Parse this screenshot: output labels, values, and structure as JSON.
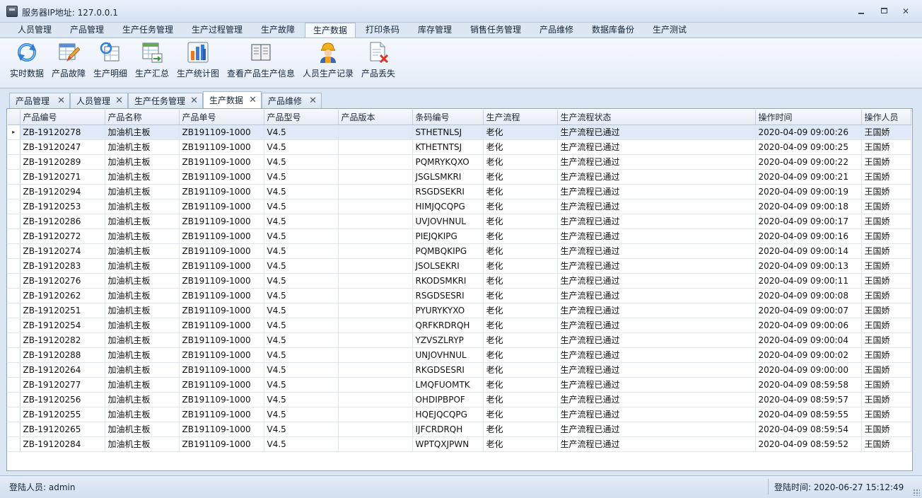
{
  "window": {
    "title": "服务器IP地址: 127.0.0.1",
    "app_icon": "server-icon"
  },
  "ribbon": {
    "tabs": [
      {
        "label": "人员管理"
      },
      {
        "label": "产品管理"
      },
      {
        "label": "生产任务管理"
      },
      {
        "label": "生产过程管理"
      },
      {
        "label": "生产故障"
      },
      {
        "label": "生产数据",
        "active": true
      },
      {
        "label": "打印条码"
      },
      {
        "label": "库存管理"
      },
      {
        "label": "销售任务管理"
      },
      {
        "label": "产品维修"
      },
      {
        "label": "数据库备份"
      },
      {
        "label": "生产测试"
      }
    ],
    "buttons": [
      {
        "label": "实时数据",
        "icon": "refresh-icon"
      },
      {
        "label": "产品故障",
        "icon": "edit-table-icon"
      },
      {
        "label": "生产明细",
        "icon": "detail-sync-icon"
      },
      {
        "label": "生产汇总",
        "icon": "summary-table-icon"
      },
      {
        "label": "生产统计图",
        "icon": "bar-chart-icon"
      },
      {
        "label": "查看产品生产信息",
        "icon": "book-icon"
      },
      {
        "label": "人员生产记录",
        "icon": "worker-icon"
      },
      {
        "label": "产品丢失",
        "icon": "delete-document-icon"
      }
    ]
  },
  "doc_tabs": [
    {
      "label": "产品管理"
    },
    {
      "label": "人员管理"
    },
    {
      "label": "生产任务管理"
    },
    {
      "label": "生产数据",
      "active": true
    },
    {
      "label": "产品维修"
    }
  ],
  "grid": {
    "columns": [
      "产品编号",
      "产品名称",
      "产品单号",
      "产品型号",
      "产品版本",
      "条码编号",
      "生产流程",
      "生产流程状态",
      "操作时间",
      "操作人员"
    ],
    "rows": [
      [
        "ZB-19120278",
        "加油机主板",
        "ZB191109-1000",
        "V4.5",
        "",
        "STHETNLSJ",
        "老化",
        "生产流程已通过",
        "2020-04-09 09:00:26",
        "王国娇"
      ],
      [
        "ZB-19120247",
        "加油机主板",
        "ZB191109-1000",
        "V4.5",
        "",
        "KTHETNTSJ",
        "老化",
        "生产流程已通过",
        "2020-04-09 09:00:25",
        "王国娇"
      ],
      [
        "ZB-19120289",
        "加油机主板",
        "ZB191109-1000",
        "V4.5",
        "",
        "PQMRYKQXO",
        "老化",
        "生产流程已通过",
        "2020-04-09 09:00:22",
        "王国娇"
      ],
      [
        "ZB-19120271",
        "加油机主板",
        "ZB191109-1000",
        "V4.5",
        "",
        "JSGLSMKRI",
        "老化",
        "生产流程已通过",
        "2020-04-09 09:00:21",
        "王国娇"
      ],
      [
        "ZB-19120294",
        "加油机主板",
        "ZB191109-1000",
        "V4.5",
        "",
        "RSGDSEKRI",
        "老化",
        "生产流程已通过",
        "2020-04-09 09:00:19",
        "王国娇"
      ],
      [
        "ZB-19120253",
        "加油机主板",
        "ZB191109-1000",
        "V4.5",
        "",
        "HIMJQCQPG",
        "老化",
        "生产流程已通过",
        "2020-04-09 09:00:18",
        "王国娇"
      ],
      [
        "ZB-19120286",
        "加油机主板",
        "ZB191109-1000",
        "V4.5",
        "",
        "UVJOVHNUL",
        "老化",
        "生产流程已通过",
        "2020-04-09 09:00:17",
        "王国娇"
      ],
      [
        "ZB-19120272",
        "加油机主板",
        "ZB191109-1000",
        "V4.5",
        "",
        "PIEJQKIPG",
        "老化",
        "生产流程已通过",
        "2020-04-09 09:00:16",
        "王国娇"
      ],
      [
        "ZB-19120274",
        "加油机主板",
        "ZB191109-1000",
        "V4.5",
        "",
        "PQMBQKIPG",
        "老化",
        "生产流程已通过",
        "2020-04-09 09:00:14",
        "王国娇"
      ],
      [
        "ZB-19120283",
        "加油机主板",
        "ZB191109-1000",
        "V4.5",
        "",
        "JSOLSEKRI",
        "老化",
        "生产流程已通过",
        "2020-04-09 09:00:13",
        "王国娇"
      ],
      [
        "ZB-19120276",
        "加油机主板",
        "ZB191109-1000",
        "V4.5",
        "",
        "RKODSMKRI",
        "老化",
        "生产流程已通过",
        "2020-04-09 09:00:11",
        "王国娇"
      ],
      [
        "ZB-19120262",
        "加油机主板",
        "ZB191109-1000",
        "V4.5",
        "",
        "RSGDSESRI",
        "老化",
        "生产流程已通过",
        "2020-04-09 09:00:08",
        "王国娇"
      ],
      [
        "ZB-19120251",
        "加油机主板",
        "ZB191109-1000",
        "V4.5",
        "",
        "PYURYKYXO",
        "老化",
        "生产流程已通过",
        "2020-04-09 09:00:07",
        "王国娇"
      ],
      [
        "ZB-19120254",
        "加油机主板",
        "ZB191109-1000",
        "V4.5",
        "",
        "QRFKRDRQH",
        "老化",
        "生产流程已通过",
        "2020-04-09 09:00:06",
        "王国娇"
      ],
      [
        "ZB-19120282",
        "加油机主板",
        "ZB191109-1000",
        "V4.5",
        "",
        "YZVSZLRYP",
        "老化",
        "生产流程已通过",
        "2020-04-09 09:00:04",
        "王国娇"
      ],
      [
        "ZB-19120288",
        "加油机主板",
        "ZB191109-1000",
        "V4.5",
        "",
        "UNJOVHNUL",
        "老化",
        "生产流程已通过",
        "2020-04-09 09:00:02",
        "王国娇"
      ],
      [
        "ZB-19120264",
        "加油机主板",
        "ZB191109-1000",
        "V4.5",
        "",
        "RKGDSESRI",
        "老化",
        "生产流程已通过",
        "2020-04-09 09:00:00",
        "王国娇"
      ],
      [
        "ZB-19120277",
        "加油机主板",
        "ZB191109-1000",
        "V4.5",
        "",
        "LMQFUOMTK",
        "老化",
        "生产流程已通过",
        "2020-04-09 08:59:58",
        "王国娇"
      ],
      [
        "ZB-19120256",
        "加油机主板",
        "ZB191109-1000",
        "V4.5",
        "",
        "OHDIPBPOF",
        "老化",
        "生产流程已通过",
        "2020-04-09 08:59:57",
        "王国娇"
      ],
      [
        "ZB-19120255",
        "加油机主板",
        "ZB191109-1000",
        "V4.5",
        "",
        "HQEJQCQPG",
        "老化",
        "生产流程已通过",
        "2020-04-09 08:59:55",
        "王国娇"
      ],
      [
        "ZB-19120265",
        "加油机主板",
        "ZB191109-1000",
        "V4.5",
        "",
        "IJFCRDRQH",
        "老化",
        "生产流程已通过",
        "2020-04-09 08:59:54",
        "王国娇"
      ],
      [
        "ZB-19120284",
        "加油机主板",
        "ZB191109-1000",
        "V4.5",
        "",
        "WPTQXJPWN",
        "老化",
        "生产流程已通过",
        "2020-04-09 08:59:52",
        "王国娇"
      ]
    ],
    "selected_row_marker": "▸"
  },
  "status": {
    "left": "登陆人员: admin",
    "right": "登陆时间: 2020-06-27 15:12:49"
  },
  "colors": {
    "selected_row": "#dfe9f7",
    "chrome": "#dbe6f4",
    "border": "#a8bcd8"
  }
}
